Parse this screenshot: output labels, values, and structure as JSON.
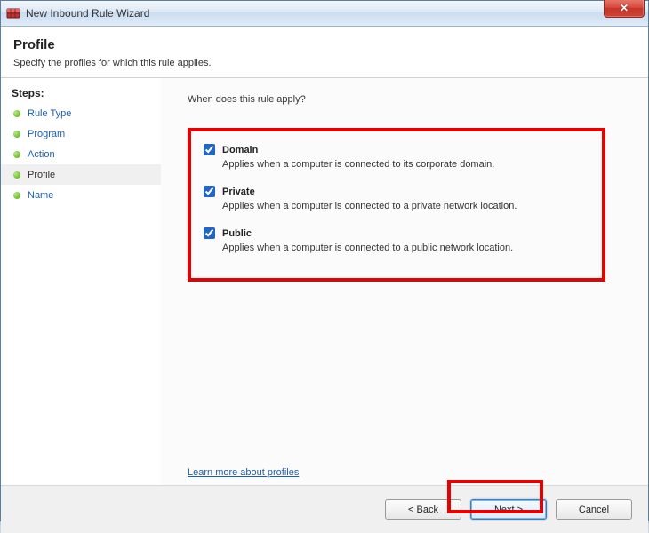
{
  "window": {
    "title": "New Inbound Rule Wizard"
  },
  "header": {
    "title": "Profile",
    "subtitle": "Specify the profiles for which this rule applies."
  },
  "sidebar": {
    "title": "Steps:",
    "items": [
      {
        "label": "Rule Type",
        "active": false
      },
      {
        "label": "Program",
        "active": false
      },
      {
        "label": "Action",
        "active": false
      },
      {
        "label": "Profile",
        "active": true
      },
      {
        "label": "Name",
        "active": false
      }
    ]
  },
  "main": {
    "question": "When does this rule apply?",
    "options": [
      {
        "label": "Domain",
        "checked": true,
        "desc": "Applies when a computer is connected to its corporate domain."
      },
      {
        "label": "Private",
        "checked": true,
        "desc": "Applies when a computer is connected to a private network location."
      },
      {
        "label": "Public",
        "checked": true,
        "desc": "Applies when a computer is connected to a public network location."
      }
    ],
    "learn_link": "Learn more about profiles"
  },
  "footer": {
    "back": "< Back",
    "next": "Next >",
    "cancel": "Cancel"
  }
}
